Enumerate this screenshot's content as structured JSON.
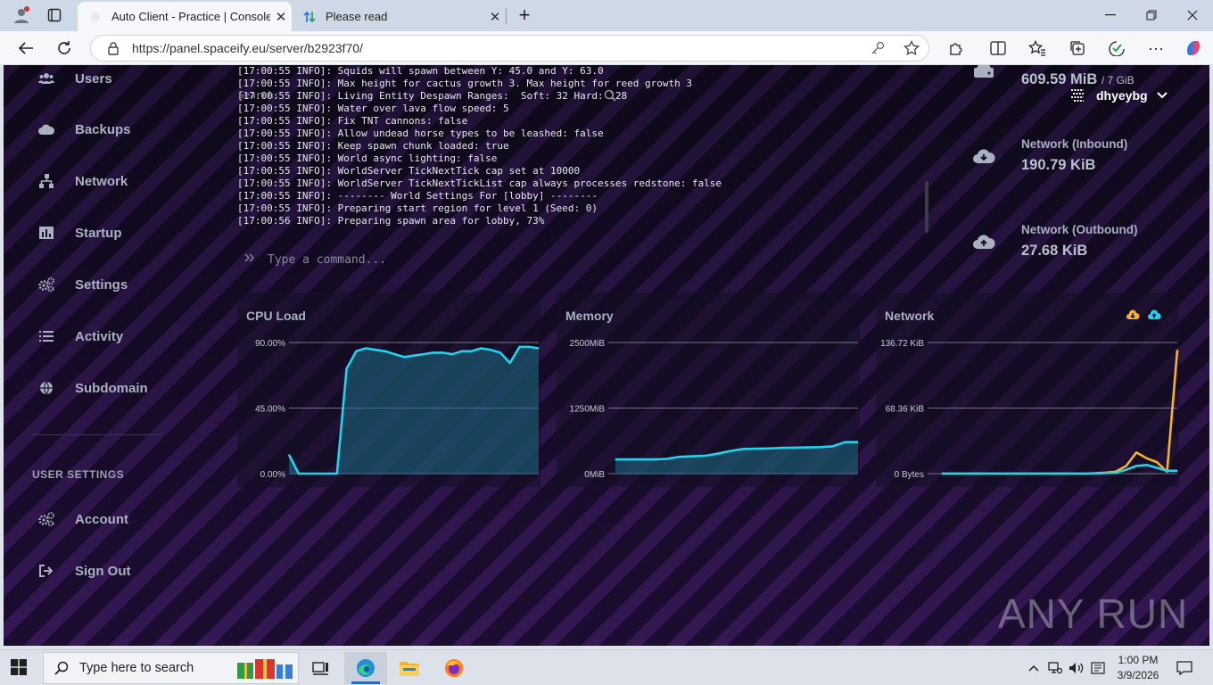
{
  "browser": {
    "tabs": [
      {
        "title": "Auto Client - Practice | Console",
        "active": true
      },
      {
        "title": "Please read",
        "active": false
      }
    ],
    "url": "https://panel.spaceify.eu/server/b2923f70/"
  },
  "sidebar": {
    "items": [
      {
        "label": "Users",
        "icon": "users-icon"
      },
      {
        "label": "Backups",
        "icon": "cloud-icon"
      },
      {
        "label": "Network",
        "icon": "network-icon"
      },
      {
        "label": "Startup",
        "icon": "chart-icon"
      },
      {
        "label": "Settings",
        "icon": "cogs-icon"
      },
      {
        "label": "Activity",
        "icon": "list-icon"
      },
      {
        "label": "Subdomain",
        "icon": "globe-icon"
      }
    ],
    "user_settings_heading": "USER SETTINGS",
    "user_items": [
      {
        "label": "Account",
        "icon": "cogs-icon"
      },
      {
        "label": "Sign Out",
        "icon": "sign-out-icon"
      }
    ]
  },
  "console": {
    "search_placeholder": "Search...",
    "lines": [
      "[17:00:55 INFO]: Squids will spawn between Y: 45.0 and Y: 63.0",
      "[17:00:55 INFO]: Max height for cactus growth 3. Max height for reed growth 3",
      "[17:00:55 INFO]: Living Entity Despawn Ranges:  Soft: 32 Hard: 128",
      "[17:00:55 INFO]: Water over lava flow speed: 5",
      "[17:00:55 INFO]: Fix TNT cannons: false",
      "[17:00:55 INFO]: Allow undead horse types to be leashed: false",
      "[17:00:55 INFO]: Keep spawn chunk loaded: true",
      "[17:00:55 INFO]: World async lighting: false",
      "[17:00:55 INFO]: WorldServer TickNextTick cap set at 10000",
      "[17:00:55 INFO]: WorldServer TickNextTickList cap always processes redstone: false",
      "[17:00:55 INFO]: -------- World Settings For [lobby] --------",
      "[17:00:55 INFO]: Preparing start region for level 1 (Seed: 0)",
      "[17:00:56 INFO]: Preparing spawn area for lobby, 73%"
    ],
    "command_placeholder": "Type a command..."
  },
  "user_menu": {
    "username": "dhyeybg"
  },
  "stats": [
    {
      "label": "",
      "value": "609.59 MiB",
      "suffix": "/ 7 GiB",
      "icon": "hdd-icon"
    },
    {
      "label": "Network (Inbound)",
      "value": "190.79 KiB",
      "suffix": "",
      "icon": "cloud-download-icon"
    },
    {
      "label": "Network (Outbound)",
      "value": "27.68 KiB",
      "suffix": "",
      "icon": "cloud-upload-icon"
    }
  ],
  "charts": {
    "cpu": {
      "title": "CPU Load",
      "ticks": [
        "90.00%",
        "45.00%",
        "0.00%"
      ]
    },
    "memory": {
      "title": "Memory",
      "ticks": [
        "2500MiB",
        "1250MiB",
        "0MiB"
      ]
    },
    "network": {
      "title": "Network",
      "ticks": [
        "136.72 KiB",
        "68.36 KiB",
        "0 Bytes"
      ]
    }
  },
  "chart_data": [
    {
      "type": "area",
      "title": "CPU Load",
      "ylim": [
        0,
        90
      ],
      "y_ticks": [
        "90.00%",
        "45.00%",
        "0.00%"
      ],
      "series": [
        {
          "values": [
            13,
            0,
            0,
            0,
            0,
            0,
            72,
            84,
            86,
            85,
            84,
            82,
            80,
            81,
            82,
            83,
            83,
            82,
            84,
            84,
            86,
            85,
            83,
            76,
            87,
            87,
            86
          ],
          "color": "#22d3ee"
        }
      ]
    },
    {
      "type": "area",
      "title": "Memory",
      "ylim": [
        0,
        2500
      ],
      "y_ticks": [
        "2500MiB",
        "1250MiB",
        "0MiB"
      ],
      "series": [
        {
          "values": [
            270,
            270,
            270,
            270,
            280,
            320,
            330,
            340,
            380,
            430,
            470,
            475,
            480,
            490,
            495,
            500,
            505,
            520,
            600,
            600
          ],
          "color": "#22d3ee"
        }
      ]
    },
    {
      "type": "line",
      "title": "Network",
      "ylim": [
        0,
        136.72
      ],
      "y_ticks": [
        "136.72 KiB",
        "68.36 KiB",
        "0 Bytes"
      ],
      "series": [
        {
          "values": [
            0,
            0,
            0,
            0,
            0,
            0,
            0,
            0,
            0,
            0,
            0,
            0,
            0,
            0,
            0,
            0.5,
            1,
            2,
            8,
            22,
            16,
            12,
            2,
            129
          ],
          "color": "#f5b32f"
        },
        {
          "values": [
            0,
            0,
            0,
            0,
            0,
            0,
            0,
            0,
            0,
            0,
            0,
            0,
            0,
            0,
            0,
            0,
            0.5,
            1,
            4,
            8,
            9,
            6,
            3,
            3
          ],
          "color": "#22d3ee"
        }
      ]
    }
  ],
  "watermark": "ANY RUN",
  "taskbar": {
    "search_placeholder": "Type here to search",
    "time": "1:00 PM",
    "date": "3/9/2026"
  }
}
